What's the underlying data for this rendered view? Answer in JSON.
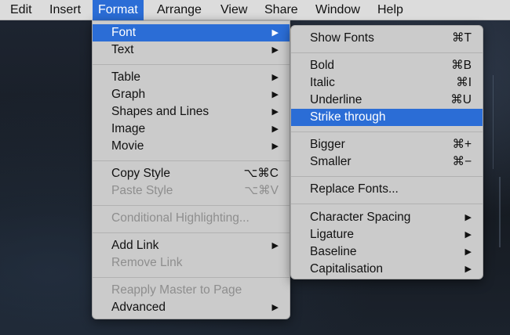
{
  "menubar": {
    "items": [
      "Edit",
      "Insert",
      "Format",
      "Arrange",
      "View",
      "Share",
      "Window",
      "Help"
    ],
    "active": "Format"
  },
  "format_menu": {
    "font": "Font",
    "text": "Text",
    "table": "Table",
    "graph": "Graph",
    "shapes_and_lines": "Shapes and Lines",
    "image": "Image",
    "movie": "Movie",
    "copy_style": "Copy Style",
    "copy_style_shortcut": "⌥⌘C",
    "paste_style": "Paste Style",
    "paste_style_shortcut": "⌥⌘V",
    "conditional_highlighting": "Conditional Highlighting...",
    "add_link": "Add Link",
    "remove_link": "Remove Link",
    "reapply_master": "Reapply Master to Page",
    "advanced": "Advanced"
  },
  "font_submenu": {
    "show_fonts": "Show Fonts",
    "show_fonts_shortcut": "⌘T",
    "bold": "Bold",
    "bold_shortcut": "⌘B",
    "italic": "Italic",
    "italic_shortcut": "⌘I",
    "underline": "Underline",
    "underline_shortcut": "⌘U",
    "strike_through": "Strike through",
    "bigger": "Bigger",
    "bigger_shortcut": "⌘+",
    "smaller": "Smaller",
    "smaller_shortcut": "⌘−",
    "replace_fonts": "Replace Fonts...",
    "character_spacing": "Character Spacing",
    "ligature": "Ligature",
    "baseline": "Baseline",
    "capitalisation": "Capitalisation"
  },
  "icons": {
    "submenu_arrow": "▶"
  },
  "colors": {
    "highlight": "#2b6dd6",
    "menu_background": "#cbcbcb",
    "disabled_text": "#8e8e8e"
  }
}
